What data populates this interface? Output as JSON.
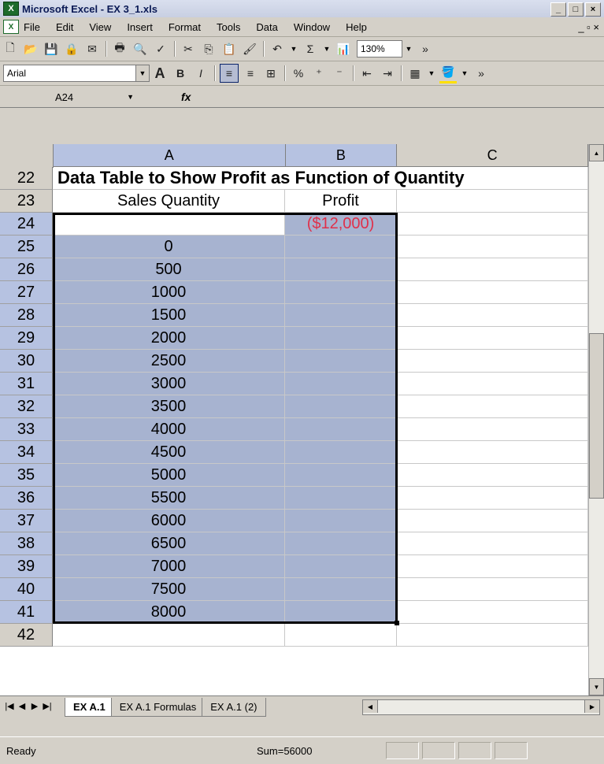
{
  "window": {
    "title": "Microsoft Excel - EX 3_1.xls",
    "controls": [
      "_",
      "□",
      "×"
    ]
  },
  "menu": {
    "items": [
      "File",
      "Edit",
      "View",
      "Insert",
      "Format",
      "Tools",
      "Data",
      "Window",
      "Help"
    ],
    "right": "_ ▫ ×"
  },
  "toolbar": {
    "zoom": "130%",
    "font": "Arial"
  },
  "formula_bar": {
    "name_box": "A24",
    "fx": "fx"
  },
  "columns": [
    "A",
    "B",
    "C"
  ],
  "title_text": "Data Table to Show Profit as Function of Quantity",
  "headers": {
    "qty": "Sales Quantity",
    "profit": "Profit"
  },
  "profit_value": "($12,000)",
  "row_numbers": [
    "22",
    "23",
    "24",
    "25",
    "26",
    "27",
    "28",
    "29",
    "30",
    "31",
    "32",
    "33",
    "34",
    "35",
    "36",
    "37",
    "38",
    "39",
    "40",
    "41",
    "42"
  ],
  "quantities": [
    "0",
    "500",
    "1000",
    "1500",
    "2000",
    "2500",
    "3000",
    "3500",
    "4000",
    "4500",
    "5000",
    "5500",
    "6000",
    "6500",
    "7000",
    "7500",
    "8000"
  ],
  "tabs": [
    "EX A.1",
    "EX A.1 Formulas",
    "EX A.1 (2)"
  ],
  "status": {
    "ready": "Ready",
    "sum": "Sum=56000"
  },
  "colors": {
    "selection": "#a7b3d0",
    "negative": "#e0304a",
    "header_selected": "#b6c2e1"
  }
}
